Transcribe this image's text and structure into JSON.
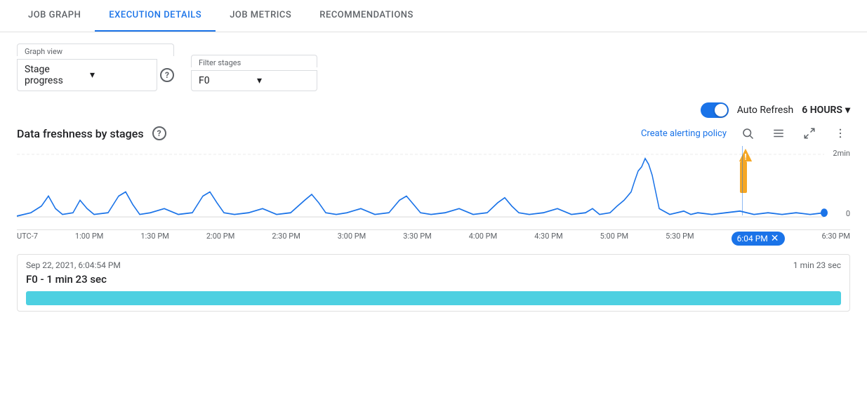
{
  "tabs": [
    {
      "id": "job-graph",
      "label": "JOB GRAPH",
      "active": false
    },
    {
      "id": "execution-details",
      "label": "EXECUTION DETAILS",
      "active": true
    },
    {
      "id": "job-metrics",
      "label": "JOB METRICS",
      "active": false
    },
    {
      "id": "recommendations",
      "label": "RECOMMENDATIONS",
      "active": false
    }
  ],
  "controls": {
    "graph_view_label": "Graph view",
    "graph_view_value": "Stage progress",
    "filter_stages_label": "Filter stages",
    "filter_stages_value": "F0"
  },
  "auto_refresh": {
    "label": "Auto Refresh",
    "hours_label": "6 HOURS"
  },
  "chart": {
    "title": "Data freshness by stages",
    "create_alert_label": "Create alerting policy",
    "y_max_label": "2min",
    "y_min_label": "0",
    "x_labels": [
      "UTC-7",
      "1:00 PM",
      "1:30 PM",
      "2:00 PM",
      "2:30 PM",
      "3:00 PM",
      "3:30 PM",
      "4:00 PM",
      "4:30 PM",
      "5:00 PM",
      "5:30 PM",
      "6:04 PM",
      "6:30 PM"
    ]
  },
  "detail": {
    "timestamp": "Sep 22, 2021, 6:04:54 PM",
    "duration_right": "1 min 23 sec",
    "stage_label": "F0 - 1 min 23 sec"
  },
  "icons": {
    "chevron_down": "▾",
    "help": "?",
    "search": "⌕",
    "legend": "≡",
    "fullscreen": "⛶",
    "more": "⋮",
    "warning": "⚠"
  }
}
